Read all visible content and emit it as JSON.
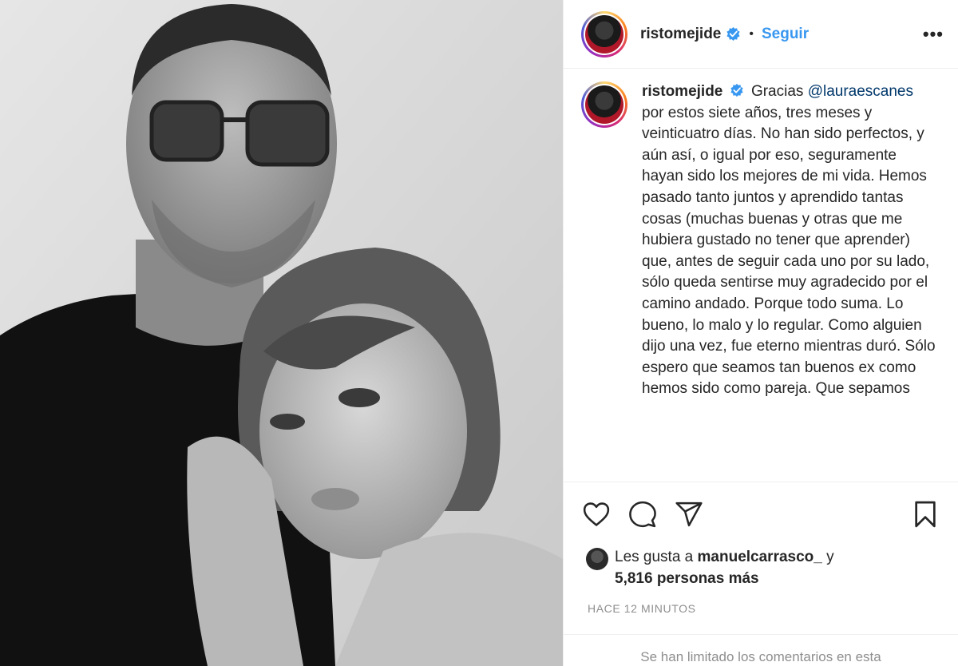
{
  "header": {
    "username": "ristomejide",
    "separator": "•",
    "follow_label": "Seguir",
    "more_label": "•••"
  },
  "caption": {
    "username": "ristomejide",
    "text_start": "Gracias",
    "mention": "@lauraescanes",
    "text_rest": "por estos siete años, tres meses y veinticuatro días. No han sido perfectos, y aún así, o igual por eso, seguramente hayan sido los mejores de mi vida. Hemos pasado tanto juntos y aprendido tantas cosas (muchas buenas y otras que me hubiera gustado no tener que aprender) que, antes de seguir cada uno por su lado, sólo queda sentirse muy agradecido por el camino andado. Porque todo suma. Lo bueno, lo malo y lo regular. Como alguien dijo una vez, fue eterno mientras duró. Sólo espero que seamos tan buenos ex como hemos sido como pareja. Que sepamos"
  },
  "likes": {
    "prefix": "Les gusta a",
    "user": "manuelcarrasco_",
    "joiner": "y",
    "count": "5,816 personas más"
  },
  "timestamp": "HACE 12 MINUTOS",
  "footer": {
    "text": "Se han limitado los comentarios en esta"
  },
  "icons": [
    "verified-badge-icon",
    "more-options-icon",
    "heart-icon",
    "comment-icon",
    "share-icon",
    "bookmark-icon"
  ],
  "colors": {
    "link": "#3897f0",
    "mention": "#00376b",
    "muted": "#8e8e8e",
    "text": "#262626",
    "verified": "#3897f0"
  }
}
